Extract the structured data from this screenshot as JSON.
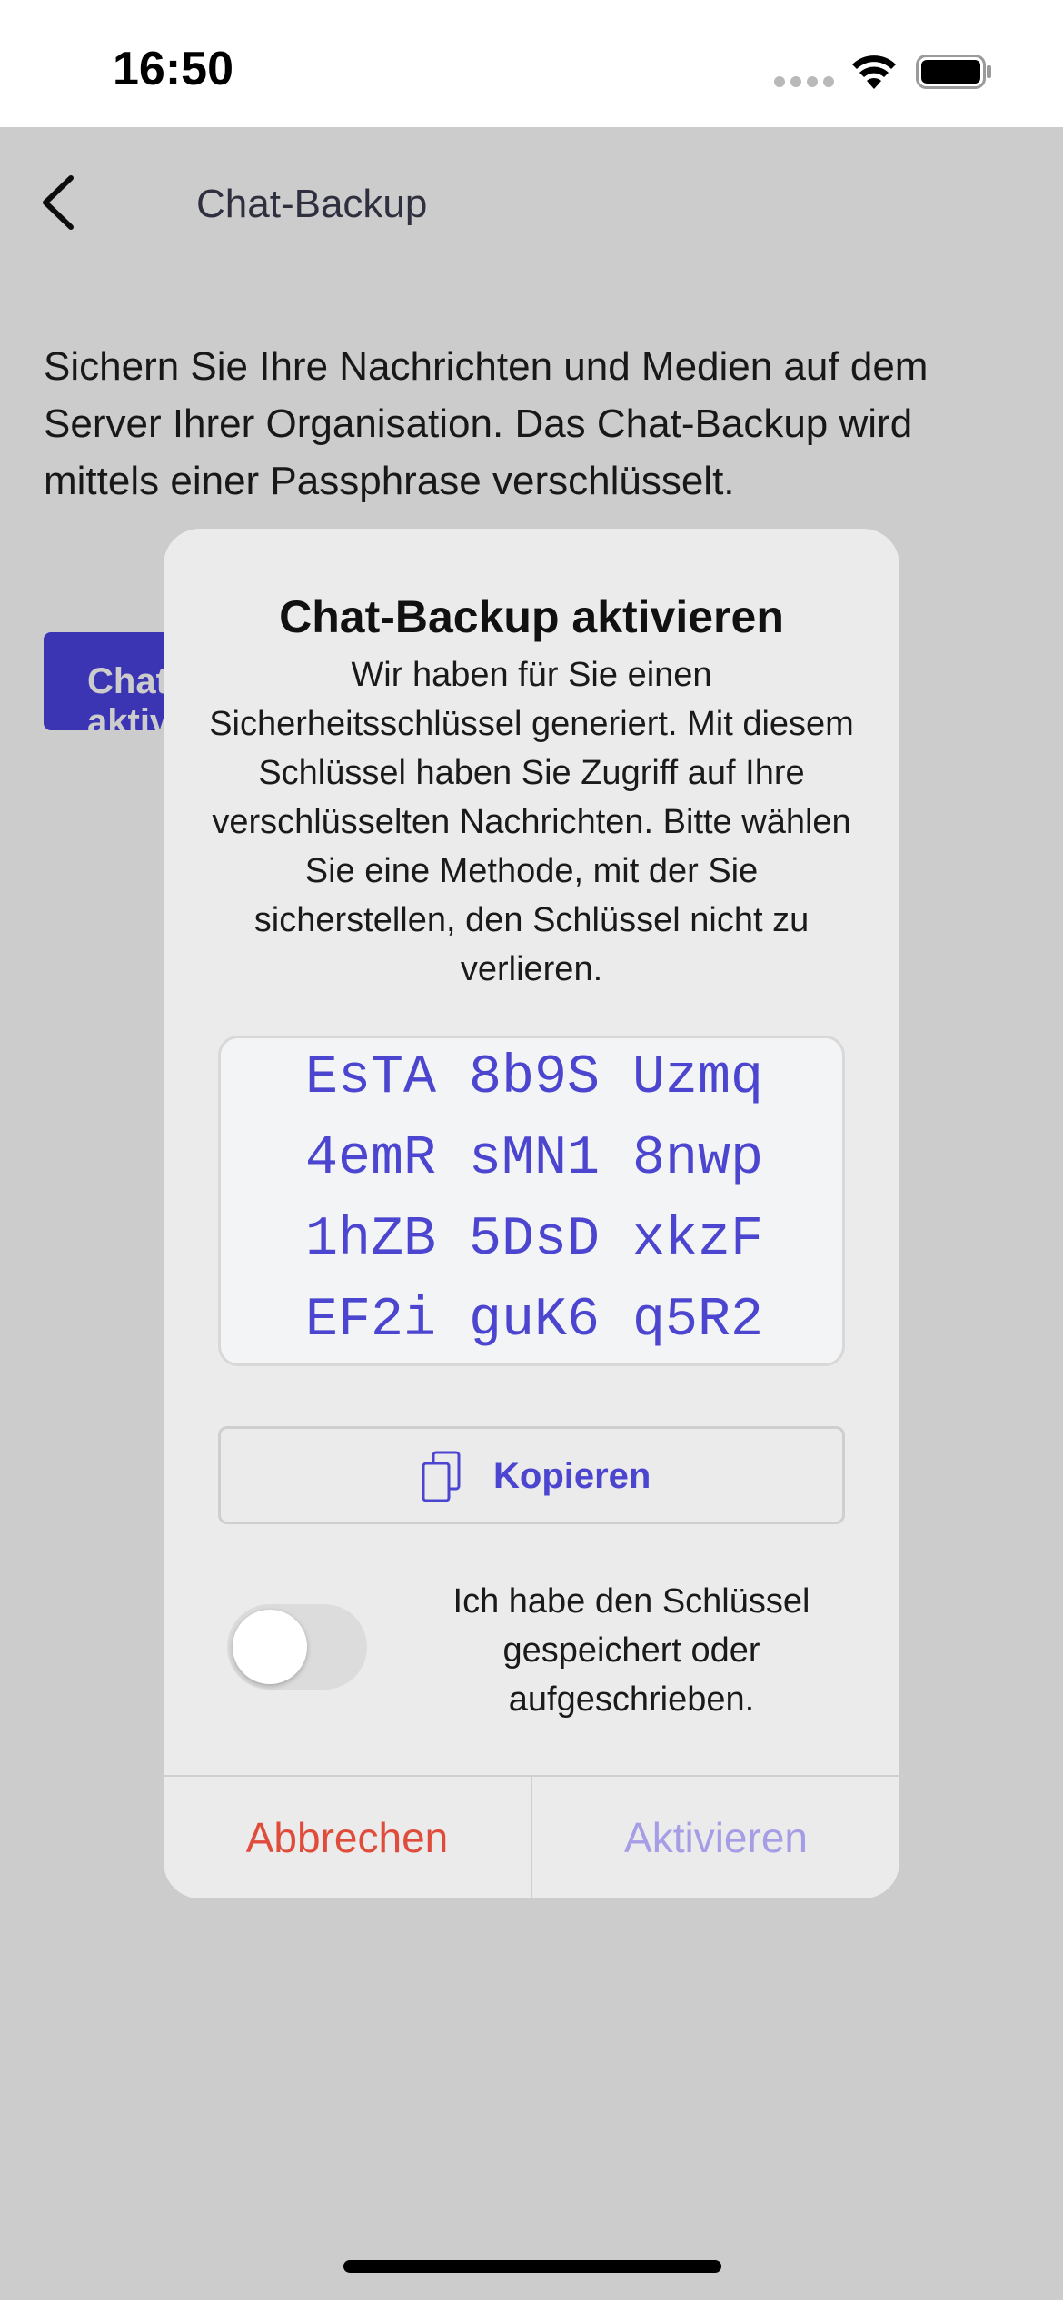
{
  "status_bar": {
    "time": "16:50",
    "signal_icon": "cellular-signal-icon",
    "wifi_icon": "wifi-icon",
    "battery_icon": "battery-icon"
  },
  "nav": {
    "back_icon": "chevron-left-icon",
    "title": "Chat-Backup"
  },
  "page": {
    "description": "Sichern Sie Ihre Nachrichten und Medien auf dem Server Ihrer Organisation. Das Chat-Backup wird mittels einer Passphrase verschlüsselt.",
    "primary_button_label": "Chat-Backup aktivieren"
  },
  "dialog": {
    "title": "Chat-Backup aktivieren",
    "message": "Wir haben für Sie einen Sicherheitsschlüssel generiert. Mit diesem Schlüssel haben Sie Zugriff auf Ihre verschlüsselten Nachrichten. Bitte wählen Sie eine Methode, mit der Sie sicherstellen, den Schlüssel nicht zu verlieren.",
    "key_rows": [
      "EsTA 8b9S Uzmq",
      "4emR sMN1 8nwp",
      "1hZB 5DsD xkzF",
      "EF2i guK6 q5R2"
    ],
    "copy_label": "Kopieren",
    "copy_icon": "copy-icon",
    "toggle_label": "Ich habe den Schlüssel gespeichert oder aufgeschrieben.",
    "toggle_on": false,
    "cancel_label": "Abbrechen",
    "activate_label": "Aktivieren",
    "activate_enabled": false
  },
  "colors": {
    "accent": "#4b45cf",
    "destructive": "#e04c3b",
    "disabled_accent": "#a59ee6"
  }
}
